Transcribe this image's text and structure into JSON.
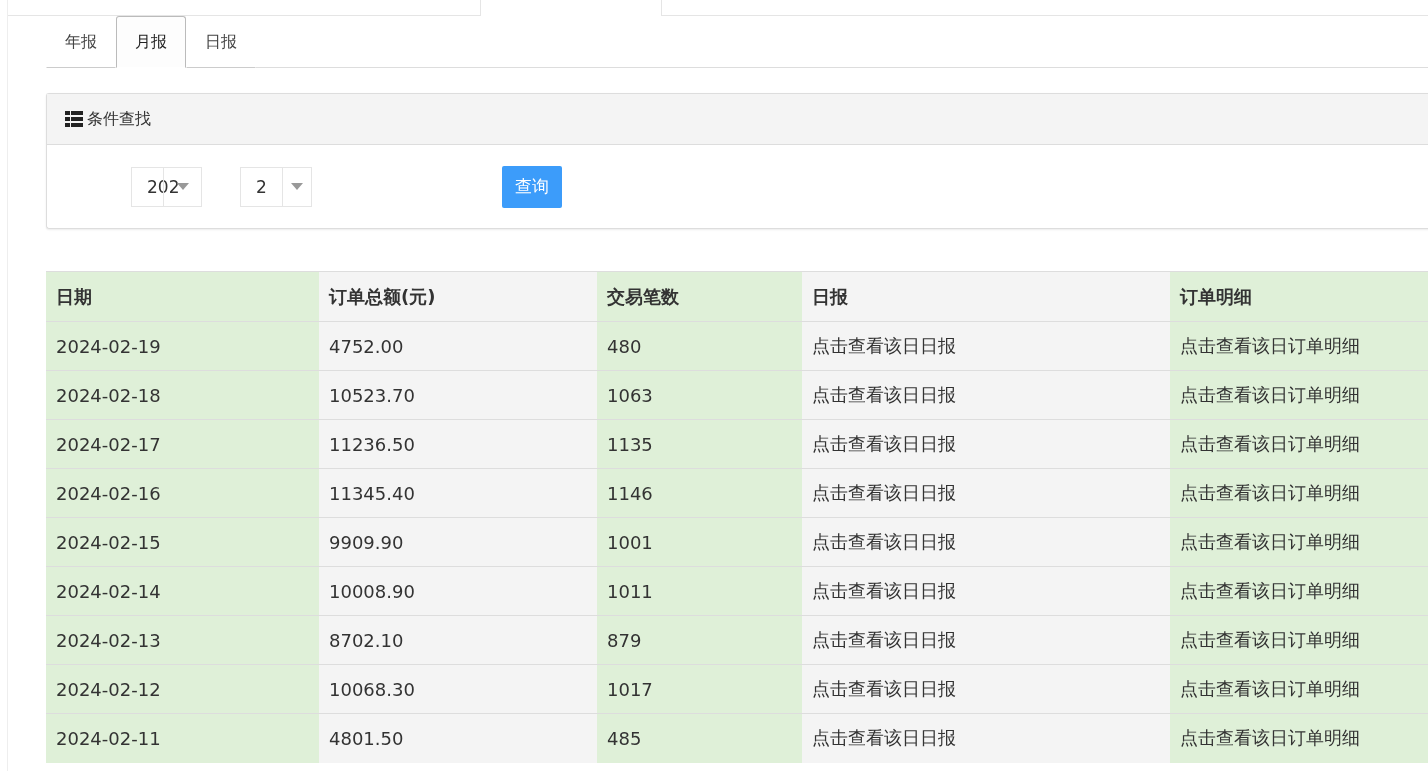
{
  "tabs": [
    {
      "label": "年报",
      "selected": false
    },
    {
      "label": "月报",
      "selected": true
    },
    {
      "label": "日报",
      "selected": false
    }
  ],
  "search_panel": {
    "title": "条件查找",
    "year_select": {
      "value": "202"
    },
    "month_select": {
      "value": "2"
    },
    "query_button": "查询"
  },
  "table": {
    "columns": [
      "日期",
      "订单总额(元)",
      "交易笔数",
      "日报",
      "订单明细"
    ],
    "rows": [
      [
        "2024-02-19",
        "4752.00",
        "480",
        "点击查看该日日报",
        "点击查看该日订单明细"
      ],
      [
        "2024-02-18",
        "10523.70",
        "1063",
        "点击查看该日日报",
        "点击查看该日订单明细"
      ],
      [
        "2024-02-17",
        "11236.50",
        "1135",
        "点击查看该日日报",
        "点击查看该日订单明细"
      ],
      [
        "2024-02-16",
        "11345.40",
        "1146",
        "点击查看该日日报",
        "点击查看该日订单明细"
      ],
      [
        "2024-02-15",
        "9909.90",
        "1001",
        "点击查看该日日报",
        "点击查看该日订单明细"
      ],
      [
        "2024-02-14",
        "10008.90",
        "1011",
        "点击查看该日日报",
        "点击查看该日订单明细"
      ],
      [
        "2024-02-13",
        "8702.10",
        "879",
        "点击查看该日日报",
        "点击查看该日订单明细"
      ],
      [
        "2024-02-12",
        "10068.30",
        "1017",
        "点击查看该日日报",
        "点击查看该日订单明细"
      ],
      [
        "2024-02-11",
        "4801.50",
        "485",
        "点击查看该日日报",
        "点击查看该日订单明细"
      ]
    ]
  }
}
